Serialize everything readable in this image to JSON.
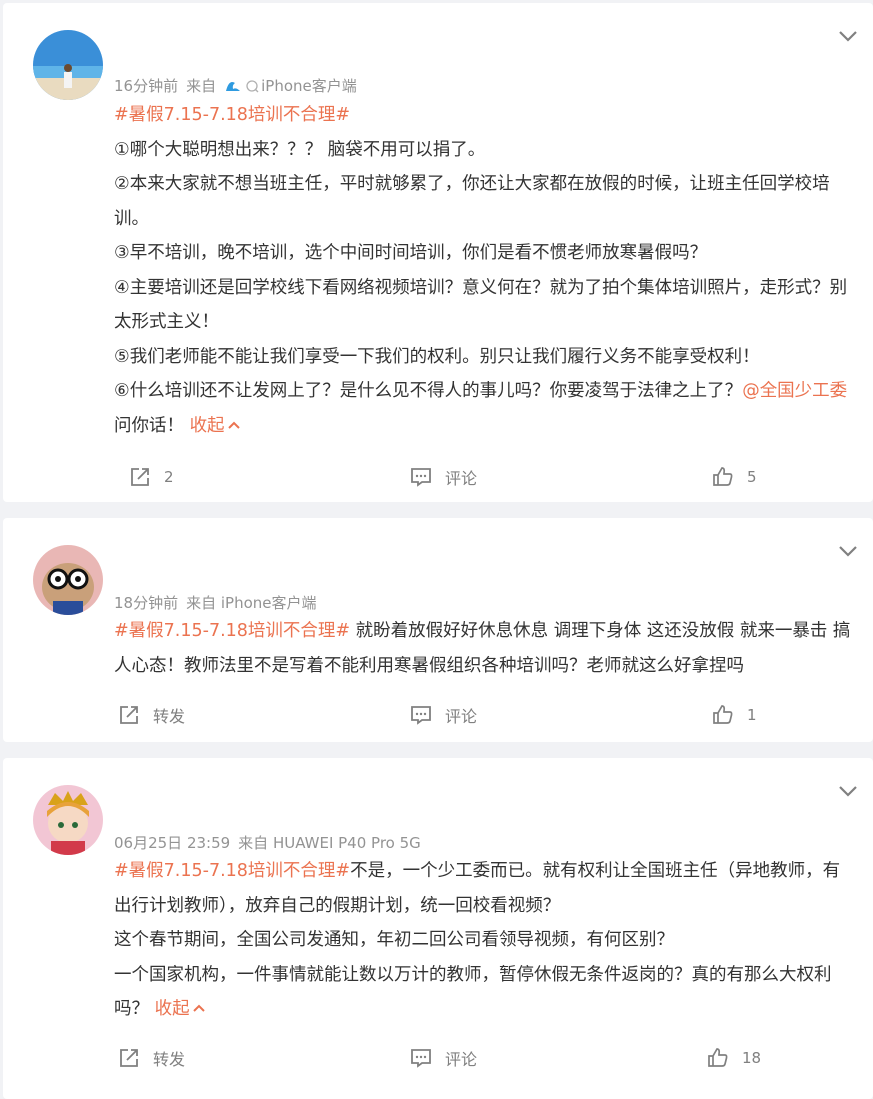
{
  "posts": [
    {
      "time": "16分钟前",
      "source": "来自",
      "source_app": "iPhone客户端",
      "hashtag": "#暑假7.15-7.18培训不合理#",
      "lines": [
        "①哪个大聪明想出来？？？ 脑袋不用可以捐了。",
        "②本来大家就不想当班主任，平时就够累了，你还让大家都在放假的时候，让班主任回学校培训。",
        "③早不培训，晚不培训，选个中间时间培训，你们是看不惯老师放寒暑假吗？",
        "④主要培训还是回学校线下看网络视频培训？意义何在？就为了拍个集体培训照片，走形式？别太形式主义！",
        "⑤我们老师能不能让我们享受一下我们的权利。别只让我们履行义务不能享受权利！",
        "⑥什么培训还不让发网上了？是什么见不得人的事儿吗？你要凌驾于法律之上了？"
      ],
      "mention": "@全国少工委",
      "after_mention": " 问你话！ ",
      "collapse": "收起",
      "repost": "2",
      "comment": "评论",
      "like": "5"
    },
    {
      "time": "18分钟前",
      "source": "来自 iPhone客户端",
      "hashtag": "#暑假7.15-7.18培训不合理#",
      "text": " 就盼着放假好好休息休息 调理下身体 这还没放假 就来一暴击 搞人心态！教师法里不是写着不能利用寒暑假组织各种培训吗？老师就这么好拿捏吗",
      "repost": "转发",
      "comment": "评论",
      "like": "1"
    },
    {
      "time": "06月25日 23:59",
      "source": "来自 HUAWEI P40 Pro 5G",
      "hashtag": "#暑假7.15-7.18培训不合理#",
      "text": "不是，一个少工委而已。就有权利让全国班主任（异地教师，有出行计划教师），放弃自己的假期计划，统一回校看视频？",
      "lines": [
        "这个春节期间，全国公司发通知，年初二回公司看领导视频，有何区别？",
        "一个国家机构，一件事情就能让数以万计的教师，暂停休假无条件返岗的？真的有那么大权利吗？"
      ],
      "collapse": "收起",
      "repost": "转发",
      "comment": "评论",
      "like": "18"
    }
  ],
  "colors": {
    "accent": "#eb7350",
    "meta": "#939393",
    "text": "#333333",
    "icon": "#808080"
  },
  "icons": [
    "chevron-down-icon",
    "share-icon",
    "comment-icon",
    "thumbs-up-icon",
    "iphone-icon",
    "avatar-beach",
    "avatar-cat-glasses",
    "avatar-anime-girl"
  ]
}
